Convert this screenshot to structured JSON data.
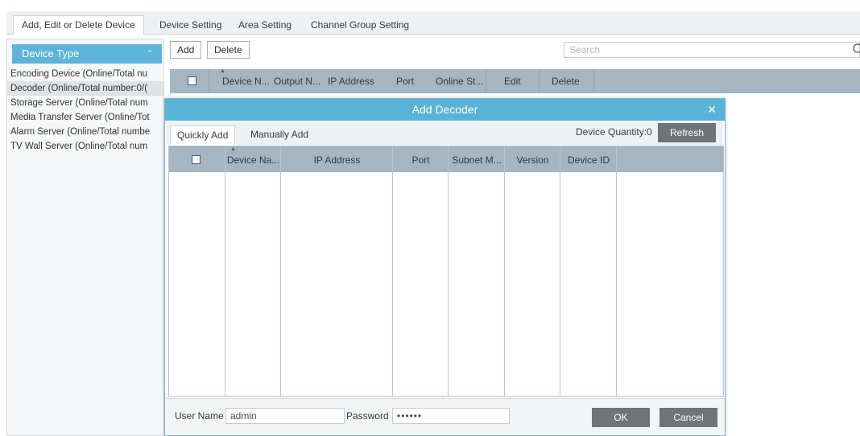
{
  "tabs": [
    {
      "label": "Add, Edit or Delete Device"
    },
    {
      "label": "Device Setting"
    },
    {
      "label": "Area Setting"
    },
    {
      "label": "Channel Group Setting"
    }
  ],
  "device_type": {
    "header": "Device Type",
    "items": [
      {
        "label": "Encoding Device (Online/Total nu"
      },
      {
        "label": "Decoder (Online/Total number:0/("
      },
      {
        "label": "Storage Server (Online/Total num"
      },
      {
        "label": "Media Transfer Server (Online/Tot"
      },
      {
        "label": "Alarm Server (Online/Total numbe"
      },
      {
        "label": "TV Wall Server (Online/Total num"
      }
    ],
    "selected_index": 1
  },
  "toolbar": {
    "add_label": "Add",
    "delete_label": "Delete",
    "search_placeholder": "Search"
  },
  "device_table": {
    "columns": [
      "Device N...",
      "Output N...",
      "IP Address",
      "Port",
      "Online St...",
      "Edit",
      "Delete"
    ]
  },
  "dialog": {
    "title": "Add Decoder",
    "tabs": [
      {
        "label": "Quickly Add"
      },
      {
        "label": "Manually Add"
      }
    ],
    "device_quantity_label": "Device Quantity:0",
    "refresh_label": "Refresh",
    "columns": [
      "Device Na...",
      "IP Address",
      "Port",
      "Subnet M...",
      "Version",
      "Device ID"
    ],
    "rows": [],
    "username_label": "User Name",
    "username_value": "admin",
    "password_label": "Password",
    "password_value": "••••••",
    "ok_label": "OK",
    "cancel_label": "Cancel"
  },
  "colors": {
    "accent": "#58b3d7",
    "header_gray": "#a4b6c1",
    "button_dark": "#6f7479"
  }
}
